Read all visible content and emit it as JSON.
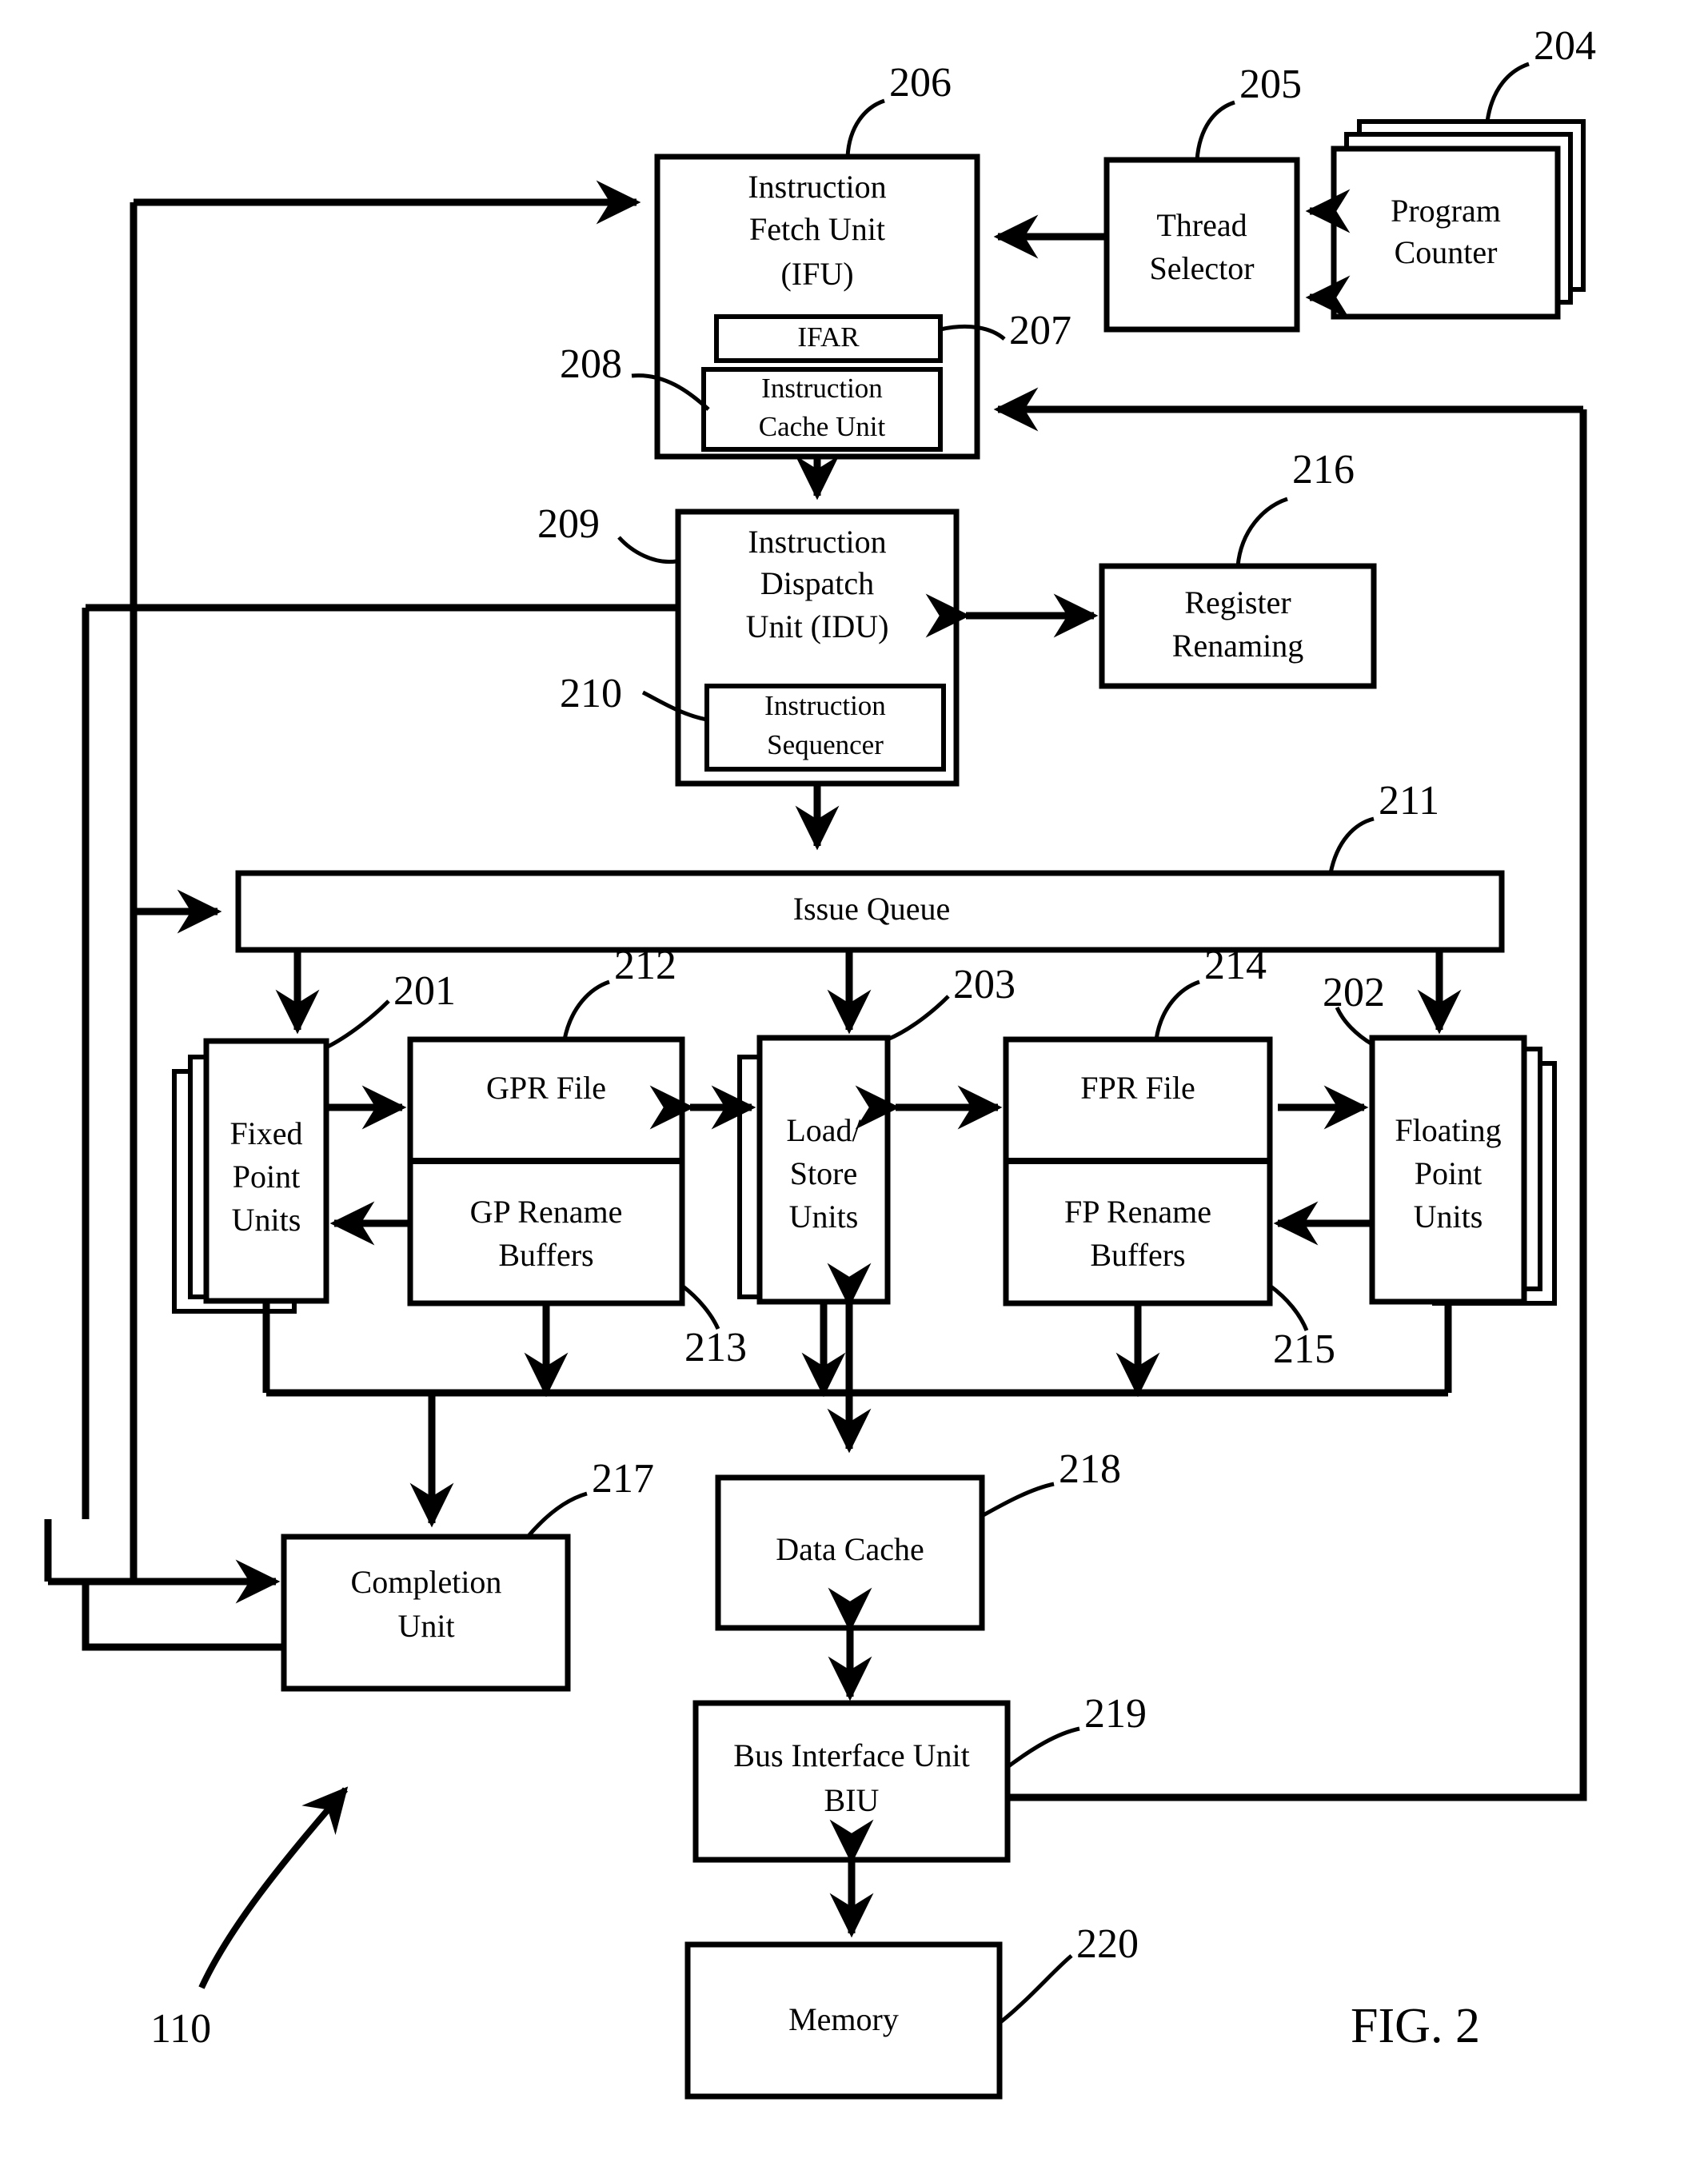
{
  "figure": {
    "label": "FIG. 2",
    "system_ref": "110"
  },
  "blocks": {
    "instruction_fetch_unit": {
      "ref": "206",
      "lines": [
        "Instruction",
        "Fetch Unit",
        "(IFU)"
      ]
    },
    "ifar": {
      "ref": "207",
      "lines": [
        "IFAR"
      ]
    },
    "instruction_cache_unit": {
      "ref": "208",
      "lines": [
        "Instruction",
        "Cache Unit"
      ]
    },
    "thread_selector": {
      "ref": "205",
      "lines": [
        "Thread",
        "Selector"
      ]
    },
    "program_counter": {
      "ref": "204",
      "lines": [
        "Program",
        "Counter"
      ]
    },
    "instruction_dispatch_unit": {
      "ref": "209",
      "lines": [
        "Instruction",
        "Dispatch",
        "Unit (IDU)"
      ]
    },
    "instruction_sequencer": {
      "ref": "210",
      "lines": [
        "Instruction",
        "Sequencer"
      ]
    },
    "register_renaming": {
      "ref": "216",
      "lines": [
        "Register",
        "Renaming"
      ]
    },
    "issue_queue": {
      "ref": "211",
      "lines": [
        "Issue Queue"
      ]
    },
    "fixed_point_units": {
      "ref": "201",
      "lines": [
        "Fixed",
        "Point",
        "Units"
      ]
    },
    "gpr_file": {
      "ref": "212",
      "lines": [
        "GPR File"
      ]
    },
    "gp_rename_buffers": {
      "ref": "213",
      "lines": [
        "GP Rename",
        "Buffers"
      ]
    },
    "load_store_units": {
      "ref": "203",
      "lines": [
        "Load/",
        "Store",
        "Units"
      ]
    },
    "fpr_file": {
      "ref": "214",
      "lines": [
        "FPR File"
      ]
    },
    "fp_rename_buffers": {
      "ref": "215",
      "lines": [
        "FP Rename",
        "Buffers"
      ]
    },
    "floating_point_units": {
      "ref": "202",
      "lines": [
        "Floating",
        "Point",
        "Units"
      ]
    },
    "completion_unit": {
      "ref": "217",
      "lines": [
        "Completion",
        "Unit"
      ]
    },
    "data_cache": {
      "ref": "218",
      "lines": [
        "Data Cache"
      ]
    },
    "bus_interface_unit": {
      "ref": "219",
      "lines": [
        "Bus Interface Unit",
        "BIU"
      ]
    },
    "memory": {
      "ref": "220",
      "lines": [
        "Memory"
      ]
    }
  },
  "refs": {
    "r201": "201",
    "r202": "202",
    "r203": "203",
    "r204": "204",
    "r205": "205",
    "r206": "206",
    "r207": "207",
    "r208": "208",
    "r209": "209",
    "r210": "210",
    "r211": "211",
    "r212": "212",
    "r213": "213",
    "r214": "214",
    "r215": "215",
    "r216": "216",
    "r217": "217",
    "r218": "218",
    "r219": "219",
    "r220": "220",
    "r110": "110"
  },
  "colors": {
    "ink": "#000000",
    "paper": "#ffffff"
  },
  "connections": [
    {
      "from": "program_counter",
      "to": "thread_selector",
      "style": "arrow"
    },
    {
      "from": "program_counter",
      "to": "thread_selector",
      "style": "arrow"
    },
    {
      "from": "thread_selector",
      "to": "instruction_fetch_unit",
      "style": "arrow"
    },
    {
      "from": "completion_unit",
      "to": "instruction_fetch_unit",
      "style": "arrow"
    },
    {
      "from": "bus_interface_unit",
      "to": "instruction_cache_unit",
      "style": "arrow"
    },
    {
      "from": "instruction_fetch_unit",
      "to": "instruction_dispatch_unit",
      "style": "arrow"
    },
    {
      "from": "instruction_dispatch_unit",
      "to": "register_renaming",
      "style": "bidirectional"
    },
    {
      "from": "instruction_dispatch_unit",
      "to": "issue_queue",
      "style": "arrow"
    },
    {
      "from": "issue_queue",
      "to": "fixed_point_units",
      "style": "arrow"
    },
    {
      "from": "issue_queue",
      "to": "load_store_units",
      "style": "arrow"
    },
    {
      "from": "issue_queue",
      "to": "floating_point_units",
      "style": "arrow"
    },
    {
      "from": "fixed_point_units",
      "to": "gpr_file",
      "style": "arrow"
    },
    {
      "from": "gp_rename_buffers",
      "to": "fixed_point_units",
      "style": "arrow"
    },
    {
      "from": "gpr_file",
      "to": "load_store_units",
      "style": "bidirectional"
    },
    {
      "from": "load_store_units",
      "to": "fpr_file",
      "style": "bidirectional"
    },
    {
      "from": "fpr_file",
      "to": "floating_point_units",
      "style": "arrow"
    },
    {
      "from": "floating_point_units",
      "to": "fp_rename_buffers",
      "style": "arrow"
    },
    {
      "from": "load_store_units",
      "to": "data_cache",
      "style": "bidirectional"
    },
    {
      "from": "data_cache",
      "to": "bus_interface_unit",
      "style": "bidirectional"
    },
    {
      "from": "bus_interface_unit",
      "to": "memory",
      "style": "bidirectional"
    },
    {
      "from": "fixed_point_units",
      "to": "completion_unit",
      "style": "arrow"
    },
    {
      "from": "load_store_units",
      "to": "completion_unit",
      "style": "arrow"
    },
    {
      "from": "floating_point_units",
      "to": "completion_unit",
      "style": "arrow"
    },
    {
      "from": "completion_unit",
      "to": "instruction_dispatch_unit",
      "style": "arrow"
    },
    {
      "from": "completion_unit",
      "to": "issue_queue",
      "style": "arrow"
    }
  ]
}
